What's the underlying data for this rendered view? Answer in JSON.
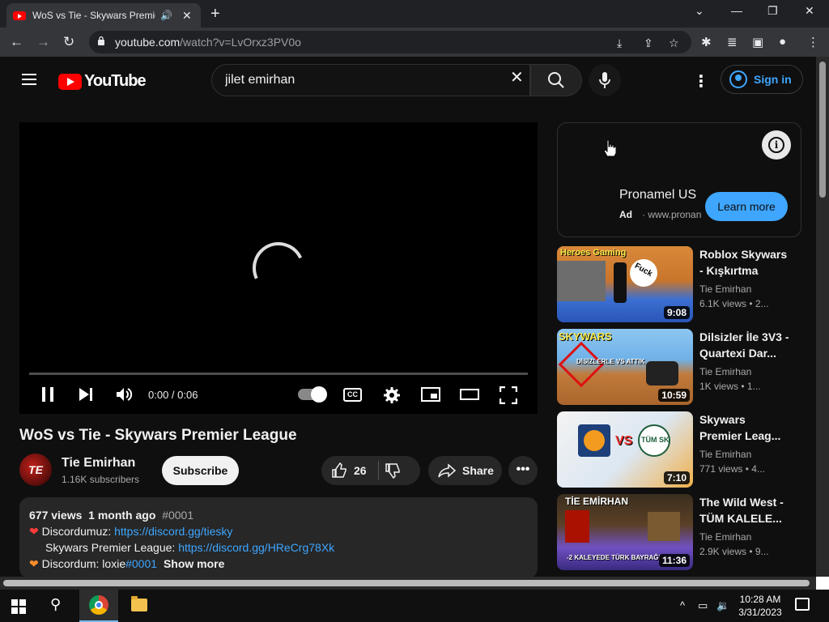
{
  "browser": {
    "tab_title": "WoS vs Tie - Skywars Premier League",
    "url_host": "youtube.com",
    "url_path": "/watch?v=LvOrxz3PV0o",
    "glyphs": {
      "audio": "🔊",
      "close": "✕",
      "new_tab": "+",
      "minimize": "—",
      "restore": "❐",
      "dropdown": "⌄",
      "back": "←",
      "forward": "→",
      "reload": "↻",
      "install": "⤓",
      "share": "⇪",
      "bookmark": "☆",
      "extensions": "✱",
      "media": "≣",
      "sidepanel": "▣",
      "profile": "●",
      "menu": "⋮"
    }
  },
  "youtube": {
    "logo_text": "YouTube",
    "search": {
      "value": "jilet emirhan",
      "clear_glyph": "✕"
    },
    "more_glyph": "⋮",
    "signin_label": "Sign in"
  },
  "player": {
    "time": "0:00 / 0:06",
    "progress": 0,
    "cc_label": "CC"
  },
  "video": {
    "title": "WoS vs Tie - Skywars Premier League",
    "channel": {
      "name": "Tie Emirhan",
      "subscribers": "1.16K subscribers",
      "avatar_text": "TE"
    },
    "subscribe_label": "Subscribe",
    "likes": "26",
    "share_label": "Share",
    "more_glyph": "•••",
    "description": {
      "views": "677 views",
      "age": "1 month ago",
      "tag": "#0001",
      "line1_label": "Discordumuz:",
      "line1_link": "https://discord.gg/tiesky",
      "line2_label": "Skywars Premier League:",
      "line2_link": "https://discord.gg/HReCrg78Xk",
      "line3_label": "Discordum: loxie",
      "line3_tag": "#0001",
      "show_more": "Show more",
      "heart": "❤"
    }
  },
  "ad": {
    "title": "Pronamel US",
    "label": "Ad",
    "url": "· www.pronan",
    "info_glyph": "i",
    "cta": "Learn more"
  },
  "recommendations": [
    {
      "title": "Roblox Skywars - Kışkırtma",
      "channel": "Tie Emirhan",
      "meta": "6.1K views  • 2...",
      "duration": "9:08",
      "thumb_text": "Heroes Gaming",
      "thumb_text2": "Fuck"
    },
    {
      "title": "Dilsizler İle 3V3 - Quartexi Dar...",
      "channel": "Tie Emirhan",
      "meta": "1K views  • 1...",
      "duration": "10:59",
      "thumb_text": "SKYWARS",
      "thumb_text2": "DİSİZLERLE VS ATTIK"
    },
    {
      "title": "Skywars Premier Leag...",
      "channel": "Tie Emirhan",
      "meta": "771 views  • 4...",
      "duration": "7:10",
      "thumb_text": "VS",
      "thumb_text2": "TÜM SK"
    },
    {
      "title": "The Wild West - TÜM KALELE...",
      "channel": "Tie Emirhan",
      "meta": "2.9K views  • 9...",
      "duration": "11:36",
      "thumb_text": "TİE EMİRHAN",
      "thumb_text2": "-2 KALEYEDE TÜRK BAYRAĞI"
    }
  ],
  "taskbar": {
    "time": "10:28 AM",
    "date": "3/31/2023",
    "tray_glyphs": {
      "chevron": "^",
      "network": "▭",
      "volume": "🔉"
    },
    "search_glyph": "⚲"
  }
}
